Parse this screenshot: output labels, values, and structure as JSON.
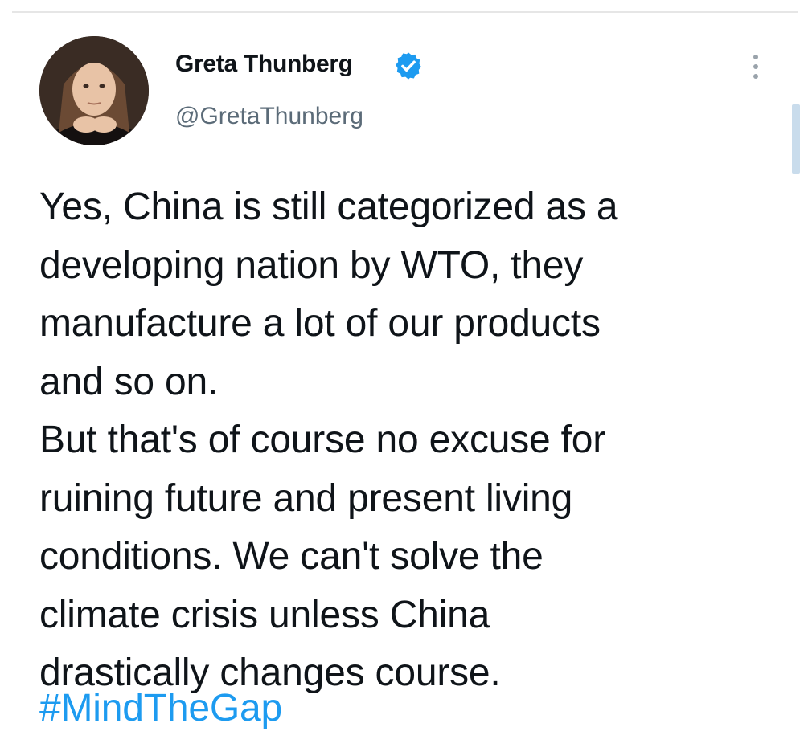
{
  "tweet": {
    "author": {
      "display_name": "Greta Thunberg",
      "handle": "@GretaThunberg",
      "verified": true,
      "avatar_icon": "profile-photo"
    },
    "text": "Yes, China is still categorized as a\ndeveloping nation by WTO, they\nmanufacture a lot of our products\nand so on.\nBut that's of course no excuse for\nruining future and present living\nconditions. We can't solve the\nclimate crisis unless China\ndrastically changes course.",
    "hashtag": "#MindTheGap",
    "more_icon": "more-vertical-icon"
  },
  "colors": {
    "link": "#1d9bf0",
    "verified_badge": "#1d9bf0",
    "handle": "#5b6b78",
    "text": "#0f1419"
  }
}
